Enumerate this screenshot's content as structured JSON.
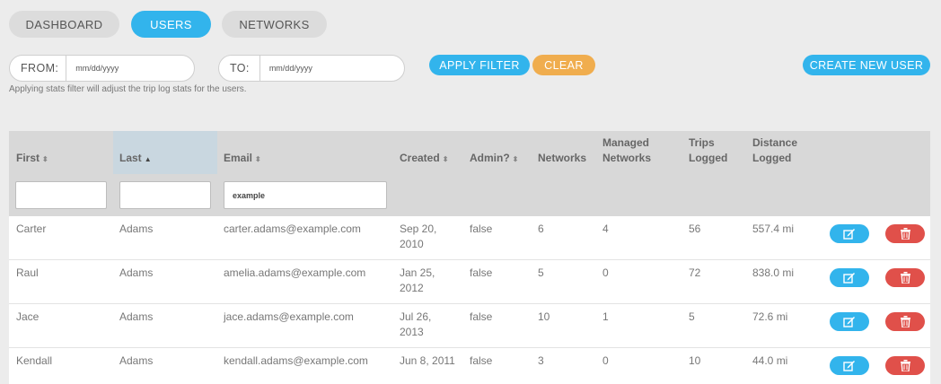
{
  "tabs": [
    {
      "label": "DASHBOARD"
    },
    {
      "label": "USERS"
    },
    {
      "label": "NETWORKS"
    }
  ],
  "filter": {
    "from_label": "FROM:",
    "from_placeholder": "mm/dd/yyyy",
    "to_label": "TO:",
    "to_placeholder": "mm/dd/yyyy",
    "apply_label": "APPLY FILTER",
    "clear_label": "CLEAR",
    "hint": "Applying stats filter will adjust the trip log stats for the users."
  },
  "create_user_label": "CREATE NEW USER",
  "colors": {
    "accent": "#32b4ec",
    "clear": "#f0ad4e",
    "delete": "#e0504a"
  },
  "table": {
    "headers": {
      "first": "First",
      "last": "Last",
      "email": "Email",
      "created": "Created",
      "admin": "Admin?",
      "networks": "Networks",
      "managed_1": "Managed",
      "managed_2": "Networks",
      "trips_1": "Trips",
      "trips_2": "Logged",
      "distance_1": "Distance",
      "distance_2": "Logged"
    },
    "sort_icons": {
      "unsorted": "⬍",
      "ascending": "▲"
    },
    "filters": {
      "first": "",
      "last": "",
      "email": "example"
    },
    "rows": [
      {
        "first": "Carter",
        "last": "Adams",
        "email": "carter.adams@example.com",
        "created_1": "Sep 20,",
        "created_2": "2010",
        "admin": "false",
        "networks": "6",
        "managed": "4",
        "trips": "56",
        "distance": "557.4 mi"
      },
      {
        "first": "Raul",
        "last": "Adams",
        "email": "amelia.adams@example.com",
        "created_1": "Jan 25,",
        "created_2": "2012",
        "admin": "false",
        "networks": "5",
        "managed": "0",
        "trips": "72",
        "distance": "838.0 mi"
      },
      {
        "first": "Jace",
        "last": "Adams",
        "email": "jace.adams@example.com",
        "created_1": "Jul 26,",
        "created_2": "2013",
        "admin": "false",
        "networks": "10",
        "managed": "1",
        "trips": "5",
        "distance": "72.6 mi"
      },
      {
        "first": "Kendall",
        "last": "Adams",
        "email": "kendall.adams@example.com",
        "created_1": "Jun 8, 2011",
        "created_2": "",
        "admin": "false",
        "networks": "3",
        "managed": "0",
        "trips": "10",
        "distance": "44.0 mi"
      }
    ]
  }
}
